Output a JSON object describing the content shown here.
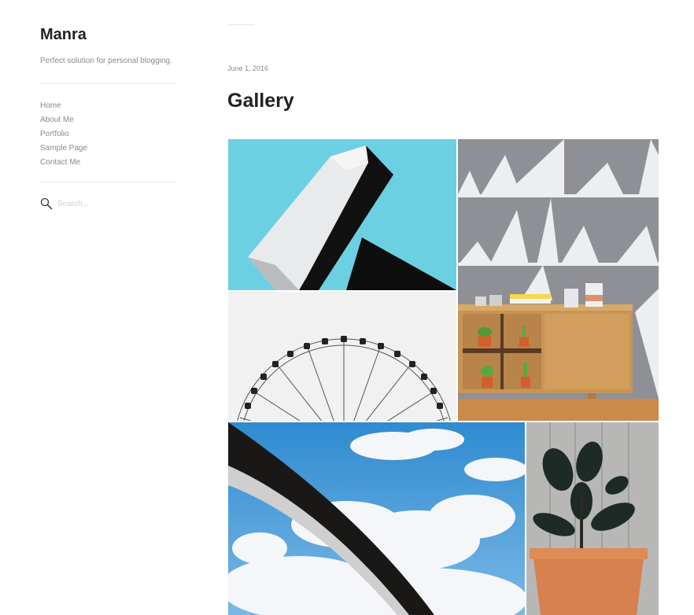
{
  "site": {
    "title": "Manra",
    "tagline": "Perfect solution for personal blogging."
  },
  "nav": {
    "items": [
      "Home",
      "About Me",
      "Portfolio",
      "Sample Page",
      "Contact Me"
    ]
  },
  "search": {
    "placeholder": "Search...",
    "icon": "magnifier-icon"
  },
  "post": {
    "date": "June 1, 2016",
    "title": "Gallery"
  },
  "gallery": {
    "images": [
      {
        "subject": "white and black architecture against blue sky"
      },
      {
        "subject": "ferris wheel on white background"
      },
      {
        "subject": "wooden sideboard with potted plants and triangle wall"
      },
      {
        "subject": "curved arch against cloudy sky"
      },
      {
        "subject": "rubber plant in terracotta pot against wooden wall"
      }
    ]
  },
  "colors": {
    "text": "#222222",
    "muted": "#8a8a8a",
    "divider": "#e8e8e8",
    "sky": "#6cd0e3"
  }
}
